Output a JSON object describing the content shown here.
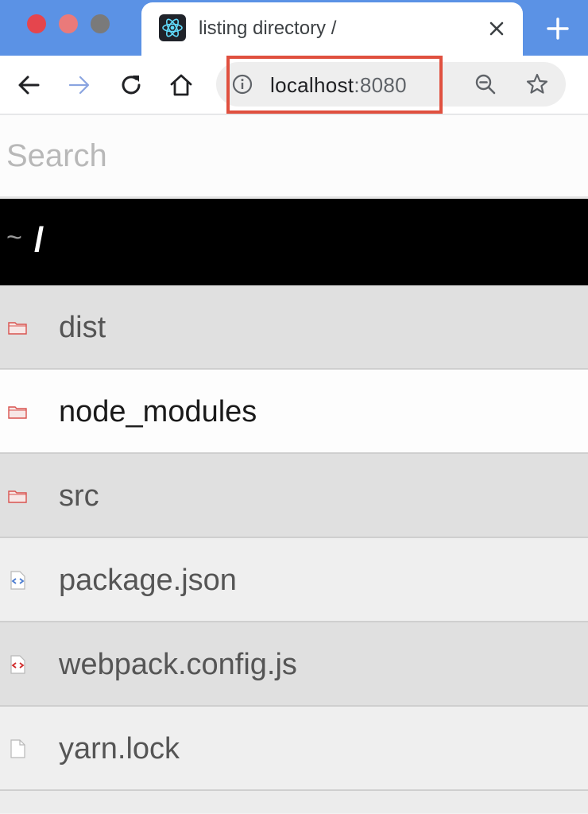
{
  "window": {
    "traffic_lights": [
      {
        "name": "close",
        "color": "#e5454d"
      },
      {
        "name": "minimize",
        "color": "#ea7a7a"
      },
      {
        "name": "zoom",
        "color": "#7a7a7a"
      }
    ]
  },
  "tab": {
    "title": "listing directory /",
    "favicon": "react-logo-icon",
    "close_icon": "close-icon"
  },
  "new_tab_icon": "plus-icon",
  "toolbar": {
    "back_icon": "back-arrow-icon",
    "forward_icon": "forward-arrow-icon",
    "reload_icon": "reload-icon",
    "home_icon": "home-icon"
  },
  "address_bar": {
    "host": "localhost",
    "port": ":8080",
    "info_icon": "info-icon",
    "zoom_icon": "zoom-out-icon",
    "bookmark_icon": "star-icon",
    "highlight_color": "#e0503f"
  },
  "search": {
    "placeholder": "Search",
    "value": ""
  },
  "path": {
    "home_symbol": "~",
    "current": "/"
  },
  "files": [
    {
      "name": "dist",
      "type": "folder",
      "icon": "folder-icon"
    },
    {
      "name": "node_modules",
      "type": "folder",
      "icon": "folder-icon"
    },
    {
      "name": "src",
      "type": "folder",
      "icon": "folder-icon"
    },
    {
      "name": "package.json",
      "type": "json",
      "icon": "json-file-icon"
    },
    {
      "name": "webpack.config.js",
      "type": "js",
      "icon": "js-file-icon"
    },
    {
      "name": "yarn.lock",
      "type": "file",
      "icon": "file-icon"
    }
  ],
  "colors": {
    "tabstrip": "#5b92e5",
    "path_bar": "#000000",
    "folder_icon": "#d9534f",
    "json_icon": "#4a7bd0",
    "js_icon": "#d02b2b"
  }
}
